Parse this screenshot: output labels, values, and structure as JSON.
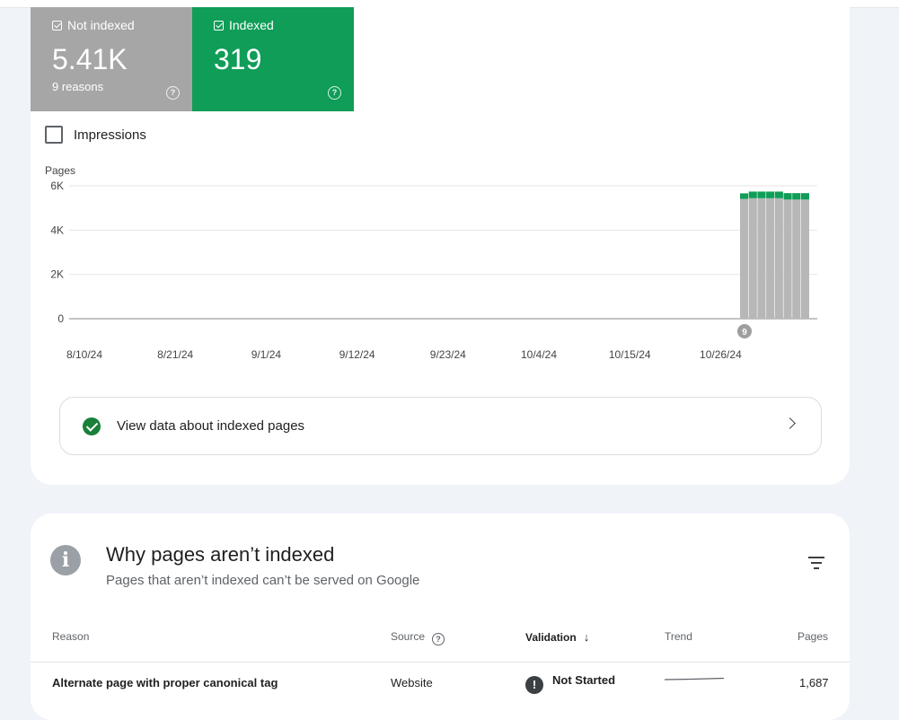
{
  "summary": {
    "not_indexed": {
      "label": "Not indexed",
      "value": "5.41K",
      "sub": "9 reasons"
    },
    "indexed": {
      "label": "Indexed",
      "value": "319"
    }
  },
  "impressions_label": "Impressions",
  "chart_data": {
    "type": "bar",
    "ylabel": "Pages",
    "y_ticks": [
      "0",
      "2K",
      "4K",
      "6K"
    ],
    "ylim": [
      0,
      6000
    ],
    "x_ticks": [
      "8/10/24",
      "8/21/24",
      "9/1/24",
      "9/12/24",
      "9/23/24",
      "10/4/24",
      "10/15/24",
      "10/26/24"
    ],
    "stacked": true,
    "series": [
      {
        "name": "Not indexed",
        "color": "#b7b7b7",
        "values": [
          5410,
          5440,
          5440,
          5440,
          5440,
          5380,
          5380,
          5380
        ]
      },
      {
        "name": "Indexed",
        "color": "#0f9d58",
        "values": [
          250,
          300,
          300,
          300,
          300,
          290,
          290,
          290
        ]
      }
    ],
    "annotation": "9",
    "grid": true
  },
  "indexed_link": "View data about indexed pages",
  "section2": {
    "title": "Why pages aren’t indexed",
    "subtitle": "Pages that aren’t indexed can’t be served on Google",
    "columns": {
      "reason": "Reason",
      "source": "Source",
      "validation": "Validation",
      "trend": "Trend",
      "pages": "Pages"
    },
    "rows": [
      {
        "reason": "Alternate page with proper canonical tag",
        "source": "Website",
        "validation": "Not Started",
        "pages": "1,687"
      }
    ]
  }
}
